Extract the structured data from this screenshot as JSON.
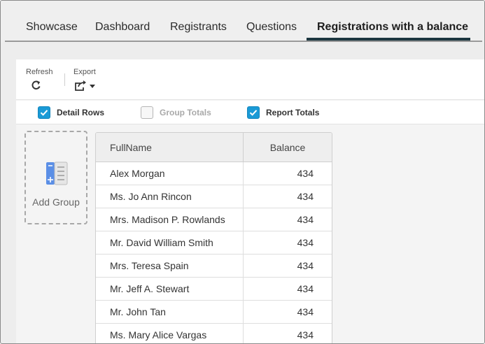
{
  "tabs": [
    {
      "label": "Showcase"
    },
    {
      "label": "Dashboard"
    },
    {
      "label": "Registrants"
    },
    {
      "label": "Questions"
    },
    {
      "label": "Registrations with a balance",
      "active": true
    }
  ],
  "toolbar": {
    "refresh_label": "Refresh",
    "export_label": "Export",
    "refresh_icon": "refresh-icon",
    "export_icon": "export-icon"
  },
  "options": {
    "detail_rows": {
      "label": "Detail Rows",
      "checked": true
    },
    "group_totals": {
      "label": "Group Totals",
      "checked": false
    },
    "report_totals": {
      "label": "Report Totals",
      "checked": true
    }
  },
  "add_group": {
    "label": "Add Group",
    "icon": "add-group-icon"
  },
  "table": {
    "columns": [
      "FullName",
      "Balance"
    ],
    "rows": [
      [
        "Alex Morgan",
        "434"
      ],
      [
        "Ms. Jo Ann Rincon",
        "434"
      ],
      [
        "Mrs. Madison P. Rowlands",
        "434"
      ],
      [
        "Mr. David William Smith",
        "434"
      ],
      [
        "Mrs. Teresa Spain",
        "434"
      ],
      [
        "Mr. Jeff A. Stewart",
        "434"
      ],
      [
        "Mr. John Tan",
        "434"
      ],
      [
        "Ms. Mary Alice Vargas",
        "434"
      ]
    ]
  },
  "colors": {
    "accent": "#1a9ad6",
    "tab_underline": "#1c3640"
  }
}
